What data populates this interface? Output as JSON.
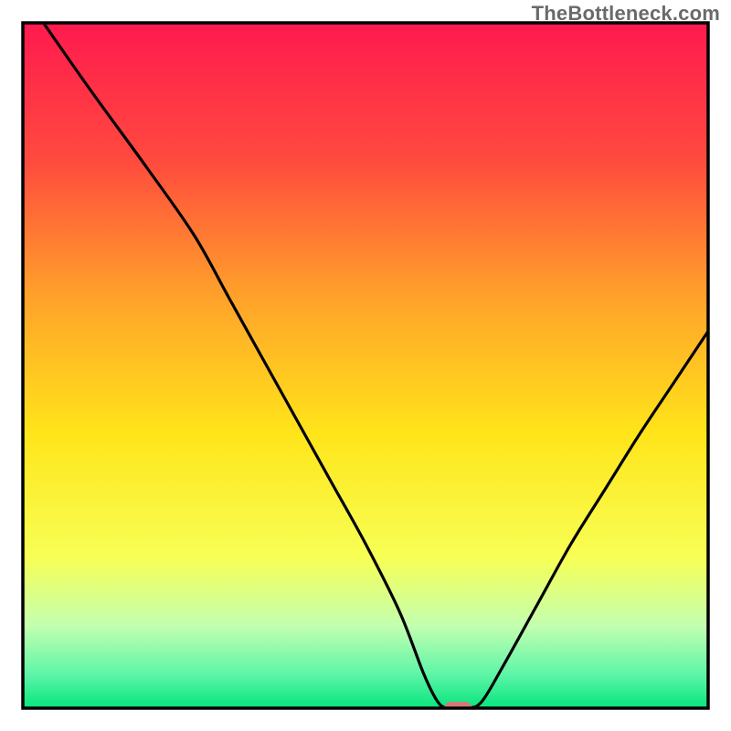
{
  "watermark": "TheBottleneck.com",
  "chart_data": {
    "type": "line",
    "title": "",
    "xlabel": "",
    "ylabel": "",
    "xlim": [
      0,
      1
    ],
    "ylim": [
      0,
      1
    ],
    "axes": {
      "x_ticks": [],
      "y_ticks": [],
      "grid": false,
      "frame": true
    },
    "background_gradient_stops": [
      {
        "offset": 0.0,
        "color": "#ff1a4f"
      },
      {
        "offset": 0.2,
        "color": "#ff4a3e"
      },
      {
        "offset": 0.4,
        "color": "#ffa22a"
      },
      {
        "offset": 0.6,
        "color": "#ffe51a"
      },
      {
        "offset": 0.78,
        "color": "#f7ff55"
      },
      {
        "offset": 0.88,
        "color": "#c3ffb0"
      },
      {
        "offset": 0.95,
        "color": "#5ff5a8"
      },
      {
        "offset": 1.0,
        "color": "#07e57e"
      }
    ],
    "marker": {
      "x": 0.635,
      "y": 0.0,
      "color": "#d37a78",
      "shape": "pill"
    },
    "series": [
      {
        "name": "curve",
        "color": "#000000",
        "points": [
          {
            "x": 0.03,
            "y": 1.0
          },
          {
            "x": 0.1,
            "y": 0.9
          },
          {
            "x": 0.18,
            "y": 0.79
          },
          {
            "x": 0.25,
            "y": 0.69
          },
          {
            "x": 0.3,
            "y": 0.6
          },
          {
            "x": 0.35,
            "y": 0.51
          },
          {
            "x": 0.4,
            "y": 0.42
          },
          {
            "x": 0.45,
            "y": 0.33
          },
          {
            "x": 0.5,
            "y": 0.24
          },
          {
            "x": 0.55,
            "y": 0.14
          },
          {
            "x": 0.585,
            "y": 0.05
          },
          {
            "x": 0.605,
            "y": 0.01
          },
          {
            "x": 0.62,
            "y": 0.0
          },
          {
            "x": 0.65,
            "y": 0.0
          },
          {
            "x": 0.67,
            "y": 0.01
          },
          {
            "x": 0.7,
            "y": 0.06
          },
          {
            "x": 0.75,
            "y": 0.15
          },
          {
            "x": 0.8,
            "y": 0.24
          },
          {
            "x": 0.85,
            "y": 0.32
          },
          {
            "x": 0.9,
            "y": 0.4
          },
          {
            "x": 0.95,
            "y": 0.475
          },
          {
            "x": 1.0,
            "y": 0.55
          }
        ]
      }
    ]
  }
}
